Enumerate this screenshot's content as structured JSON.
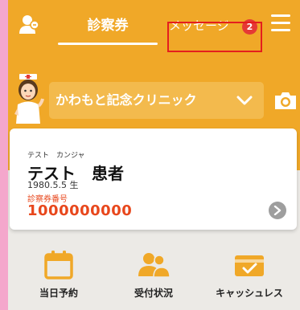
{
  "header": {
    "tabs": [
      {
        "label": "診察券",
        "active": true
      },
      {
        "label": "メッセージ",
        "badge": "2"
      }
    ]
  },
  "clinic": {
    "selected": "かわもと記念クリニック"
  },
  "patient": {
    "kana": "テスト　カンジャ",
    "name": "テスト　患者",
    "birth": "1980.5.5 生",
    "card_number_label": "診察券番号",
    "card_number": "1000000000"
  },
  "actions": [
    {
      "label": "当日予約",
      "icon": "calendar-icon"
    },
    {
      "label": "受付状況",
      "icon": "people-icon"
    },
    {
      "label": "キャッシュレス",
      "icon": "cashless-icon"
    }
  ],
  "colors": {
    "accent": "#F0A828",
    "badge": "#E53935",
    "card_number": "#E8471C",
    "page_background": "#F4A7CC"
  }
}
